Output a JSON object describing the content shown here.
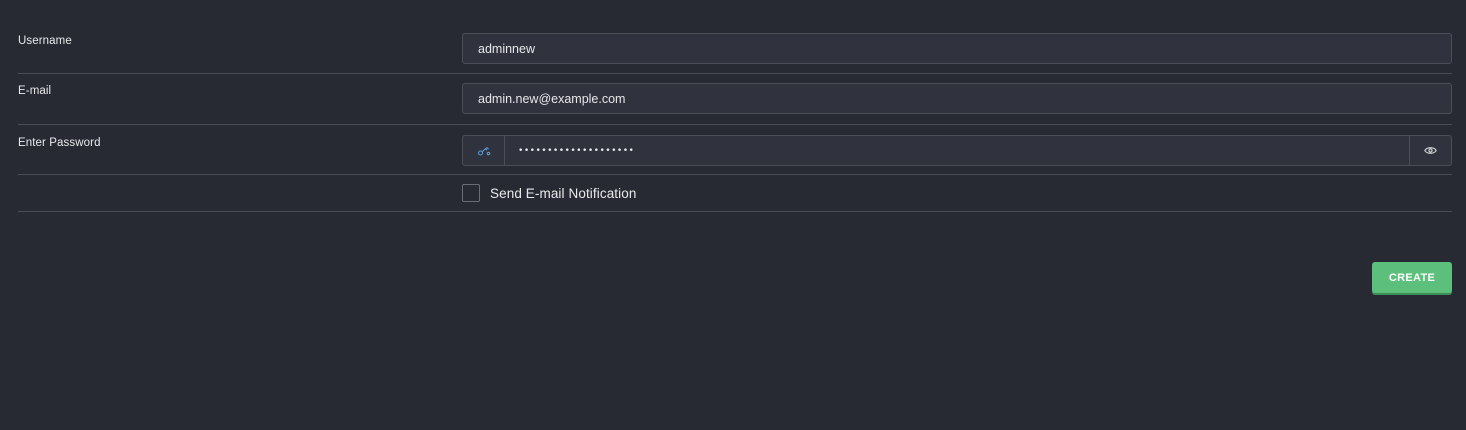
{
  "form": {
    "username": {
      "label": "Username",
      "value": "adminnew"
    },
    "email": {
      "label": "E-mail",
      "value": "admin.new@example.com"
    },
    "password": {
      "label": "Enter Password",
      "masked_value": "••••••••••••••••••••",
      "generate_icon": "key-generate-icon",
      "reveal_icon": "eye-icon"
    },
    "notification": {
      "label": "Send E-mail Notification",
      "checked": false
    }
  },
  "actions": {
    "create_label": "CREATE"
  },
  "colors": {
    "background": "#272a33",
    "input_bg": "#30333d",
    "border": "#4b4e57",
    "accent_green": "#5cbf7b",
    "icon_blue": "#5a9bd5"
  }
}
